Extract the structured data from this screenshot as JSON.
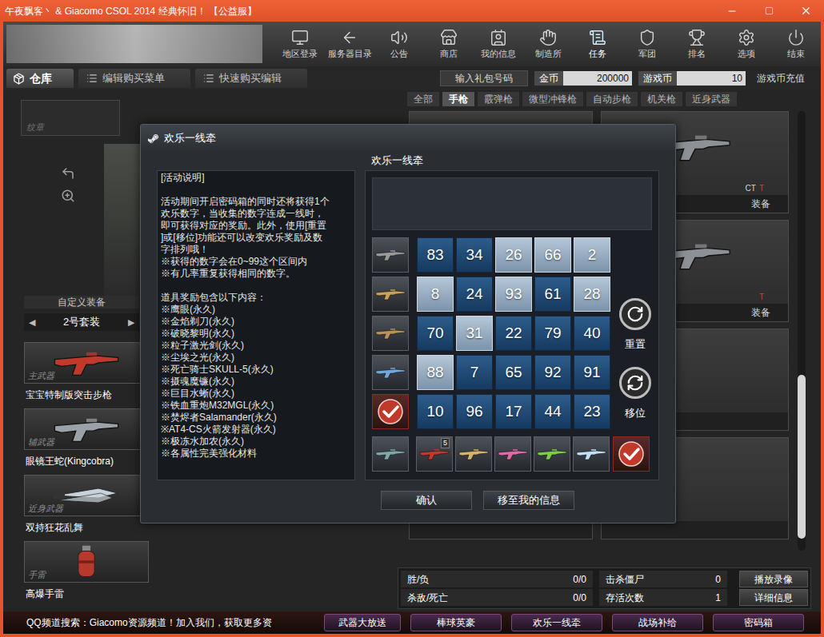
{
  "window": {
    "title": "午夜飘客丶 & Giacomo CSOL 2014 经典怀旧！ 【公益服】"
  },
  "nav": [
    {
      "label": "地区登录",
      "selected": false
    },
    {
      "label": "服务器目录",
      "selected": false
    },
    {
      "label": "公告",
      "selected": false
    },
    {
      "label": "商店",
      "selected": false
    },
    {
      "label": "我的信息",
      "selected": false
    },
    {
      "label": "制造所",
      "selected": false
    },
    {
      "label": "任务",
      "selected": true
    },
    {
      "label": "军团",
      "selected": false
    },
    {
      "label": "排名",
      "selected": false
    },
    {
      "label": "选项",
      "selected": false
    },
    {
      "label": "结束",
      "selected": false
    }
  ],
  "storage_tabs": [
    {
      "label": "仓库",
      "selected": true
    },
    {
      "label": "编辑购买菜单",
      "selected": false
    },
    {
      "label": "快速购买编辑",
      "selected": false
    }
  ],
  "gift_code_button": "输入礼包号码",
  "currencies": [
    {
      "label": "金币",
      "value": "200000"
    },
    {
      "label": "游戏币",
      "value": "10"
    }
  ],
  "recharge_button": "游戏币充值",
  "categories": [
    {
      "label": "全部",
      "selected": false
    },
    {
      "label": "手枪",
      "selected": true
    },
    {
      "label": "霰弹枪",
      "selected": false
    },
    {
      "label": "微型冲锋枪",
      "selected": false
    },
    {
      "label": "自动步枪",
      "selected": false
    },
    {
      "label": "机关枪",
      "selected": false
    },
    {
      "label": "近身武器",
      "selected": false
    }
  ],
  "emblem": "纹章",
  "loadout": {
    "title": "自定义装备",
    "prev": "◀",
    "set": "2号套装",
    "next": "▶",
    "slots": [
      {
        "slot": "主武器",
        "name": "宝宝特制版突击步枪",
        "kind": "gun",
        "color": "#c0392b"
      },
      {
        "slot": "辅武器",
        "name": "眼镜王蛇(Kingcobra)",
        "kind": "gun",
        "color": "#9aa1a8"
      },
      {
        "slot": "近身武器",
        "name": "双持狂花乱舞",
        "kind": "knife",
        "color": "#c9d2d8"
      },
      {
        "slot": "手雷",
        "name": "高爆手雷",
        "kind": "grenade",
        "color": "#b5392c"
      }
    ]
  },
  "weapon_cards": [
    {
      "teams": [
        {
          "label": "CT",
          "color": "#d6d6d6"
        },
        {
          "label": "T",
          "color": "#c8452f"
        }
      ],
      "button": "装备"
    },
    {
      "teams": [
        {
          "label": "T",
          "color": "#c8452f"
        }
      ],
      "button": "装备"
    }
  ],
  "stats_rows": [
    {
      "cells": [
        {
          "label": "胜/负",
          "value": "0/0"
        },
        {
          "label": "击杀僵尸",
          "value": "0"
        }
      ],
      "button": "播放录像"
    },
    {
      "cells": [
        {
          "label": "杀敌/死亡",
          "value": "0/0"
        },
        {
          "label": "存活次数",
          "value": "1"
        }
      ],
      "button": "详细信息"
    }
  ],
  "ticker": "QQ频道搜索：Giacomo资源频道！加入我们，获取更多资",
  "event_buttons": [
    "武器大放送",
    "棒球英豪",
    "欢乐一线牵",
    "战场补给",
    "密码箱"
  ],
  "dialog": {
    "title": "欢乐一线牵",
    "heading": "欢乐一线牵",
    "description": [
      [
        "[活动说明]"
      ],
      [
        "活动期间开启密码箱的同时还将获得1个",
        "欢乐数字，当收集的数字连成一线时，",
        "即可获得对应的奖励。此外，使用[重置",
        "]或[移位]功能还可以改变欢乐奖励及数",
        "字排列哦！",
        "※获得的数字会在0~99这个区间内",
        "※有几率重复获得相同的数字。"
      ],
      [
        "道具奖励包含以下内容：",
        "※鹰眼(永久)",
        "※金焰剃刀(永久)",
        "※破晓黎明(永久)",
        "※粒子激光剑(永久)",
        "※尘埃之光(永久)",
        "※死亡骑士SKULL-5(永久)",
        "※摄魂魔镰(永久)",
        "※巨目水蜥(永久)",
        "※铁血重炮M32MGL(永久)",
        "※焚烬者Salamander(永久)",
        "※AT4-CS火箭发射器(永久)",
        "※极冻水加农(永久)",
        "※各属性完美强化材料"
      ]
    ],
    "grid": [
      [
        {
          "number": "83",
          "collected": false
        },
        {
          "number": "34",
          "collected": false
        },
        {
          "number": "26",
          "collected": true
        },
        {
          "number": "66",
          "collected": true
        },
        {
          "number": "2",
          "collected": true
        }
      ],
      [
        {
          "number": "8",
          "collected": true
        },
        {
          "number": "24",
          "collected": false
        },
        {
          "number": "93",
          "collected": true
        },
        {
          "number": "61",
          "collected": false
        },
        {
          "number": "28",
          "collected": true
        }
      ],
      [
        {
          "number": "70",
          "collected": false
        },
        {
          "number": "31",
          "collected": true
        },
        {
          "number": "22",
          "collected": false
        },
        {
          "number": "79",
          "collected": false
        },
        {
          "number": "40",
          "collected": false
        }
      ],
      [
        {
          "number": "88",
          "collected": true
        },
        {
          "number": "7",
          "collected": false
        },
        {
          "number": "65",
          "collected": false
        },
        {
          "number": "92",
          "collected": false
        },
        {
          "number": "91",
          "collected": false
        }
      ],
      [
        {
          "number": "10",
          "collected": false
        },
        {
          "number": "96",
          "collected": false
        },
        {
          "number": "17",
          "collected": false
        },
        {
          "number": "44",
          "collected": false
        },
        {
          "number": "23",
          "collected": false
        }
      ]
    ],
    "row_rewards": [
      {
        "kind": "weapon",
        "color": "#9a9a9a"
      },
      {
        "kind": "weapon",
        "color": "#c9a15a"
      },
      {
        "kind": "weapon",
        "color": "#b8925a"
      },
      {
        "kind": "weapon",
        "color": "#6fa8dc"
      },
      {
        "kind": "check",
        "color": "#c0392b"
      }
    ],
    "column_rewards": [
      {
        "kind": "weapon",
        "color": "#c0392b",
        "badge": "5"
      },
      {
        "kind": "weapon",
        "color": "#d4b46a"
      },
      {
        "kind": "weapon",
        "color": "#e06aa8"
      },
      {
        "kind": "weapon",
        "color": "#7ccf4a"
      },
      {
        "kind": "weapon",
        "color": "#bfe3f5"
      }
    ],
    "corner_rewards": [
      {
        "kind": "weapon",
        "color": "#7fa7a8"
      },
      {
        "kind": "check",
        "color": "#c0392b"
      }
    ],
    "actions": [
      "重置",
      "移位"
    ],
    "buttons": [
      "确认",
      "移至我的信息"
    ]
  }
}
